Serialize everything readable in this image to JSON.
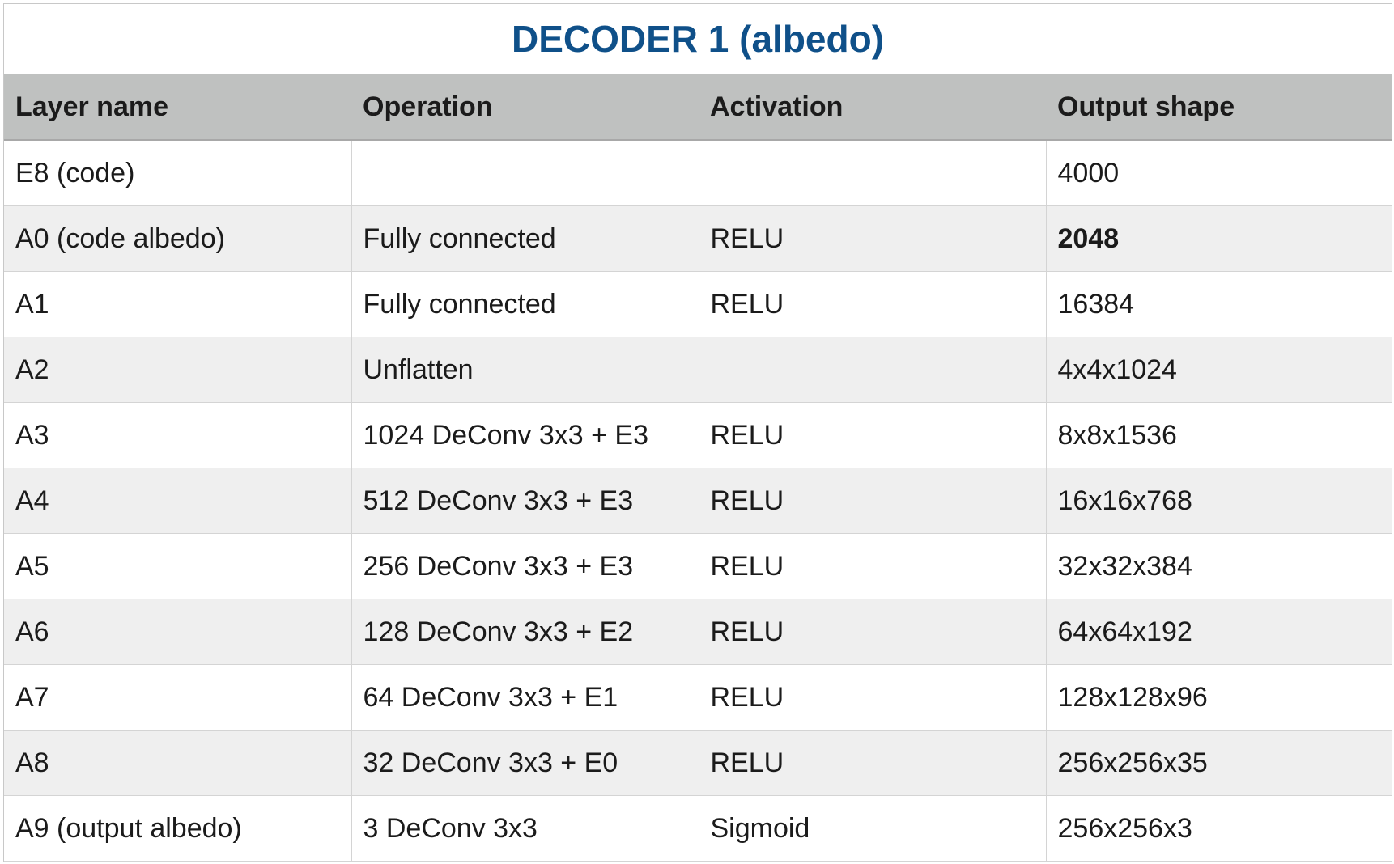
{
  "title": "DECODER 1 (albedo)",
  "headers": [
    "Layer name",
    "Operation",
    "Activation",
    "Output shape"
  ],
  "rows": [
    {
      "layer": "E8 (code)",
      "operation": "",
      "activation": "",
      "output": "4000"
    },
    {
      "layer": "A0 (code albedo)",
      "operation": "Fully connected",
      "activation": "RELU",
      "output": "2048"
    },
    {
      "layer": "A1",
      "operation": "Fully connected",
      "activation": "RELU",
      "output": "16384"
    },
    {
      "layer": "A2",
      "operation": "Unflatten",
      "activation": "",
      "output": "4x4x1024"
    },
    {
      "layer": "A3",
      "operation": "1024 DeConv 3x3 + E3",
      "activation": "RELU",
      "output": "8x8x1536"
    },
    {
      "layer": "A4",
      "operation": "512 DeConv 3x3 + E3",
      "activation": "RELU",
      "output": "16x16x768"
    },
    {
      "layer": "A5",
      "operation": "256 DeConv 3x3 + E3",
      "activation": "RELU",
      "output": "32x32x384"
    },
    {
      "layer": "A6",
      "operation": "128 DeConv 3x3 + E2",
      "activation": "RELU",
      "output": "64x64x192"
    },
    {
      "layer": "A7",
      "operation": "64 DeConv 3x3 + E1",
      "activation": "RELU",
      "output": "128x128x96"
    },
    {
      "layer": "A8",
      "operation": "32 DeConv 3x3 + E0",
      "activation": "RELU",
      "output": "256x256x35"
    },
    {
      "layer": "A9 (output albedo)",
      "operation": "3 DeConv 3x3",
      "activation": "Sigmoid",
      "output": "256x256x3"
    }
  ],
  "colors": {
    "title": "#0f5089",
    "header_bg": "#bfc1c0",
    "row_alt_bg": "#efefef"
  }
}
